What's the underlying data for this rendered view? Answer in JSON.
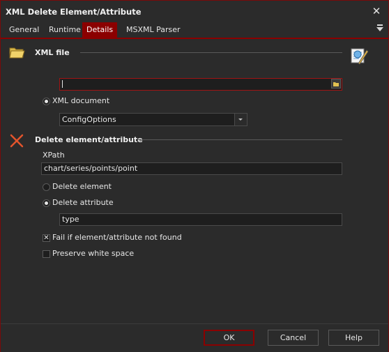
{
  "window": {
    "title": "XML Delete Element/Attribute",
    "close_icon": "close-icon"
  },
  "tabs": [
    {
      "label": "General"
    },
    {
      "label": "Runtime"
    },
    {
      "label": "Details",
      "active": true
    },
    {
      "label": "MSXML Parser"
    }
  ],
  "xml_file_section": {
    "heading": "XML file",
    "file_path_value": "",
    "xml_document_label": "XML document",
    "xml_document_selected": "ConfigOptions"
  },
  "delete_section": {
    "heading": "Delete element/attribute",
    "xpath_label": "XPath",
    "xpath_value": "chart/series/points/point",
    "delete_element_label": "Delete element",
    "delete_attribute_label": "Delete attribute",
    "attribute_value": "type",
    "fail_if_not_found_label": "Fail if element/attribute not found",
    "fail_if_not_found_checked": true,
    "preserve_whitespace_label": "Preserve white space",
    "preserve_whitespace_checked": false
  },
  "footer": {
    "ok_label": "OK",
    "cancel_label": "Cancel",
    "help_label": "Help"
  },
  "colors": {
    "accent": "#8b0000",
    "background": "#2b2b2b",
    "input_bg": "#1e1e1e",
    "text": "#e6e6e6"
  }
}
